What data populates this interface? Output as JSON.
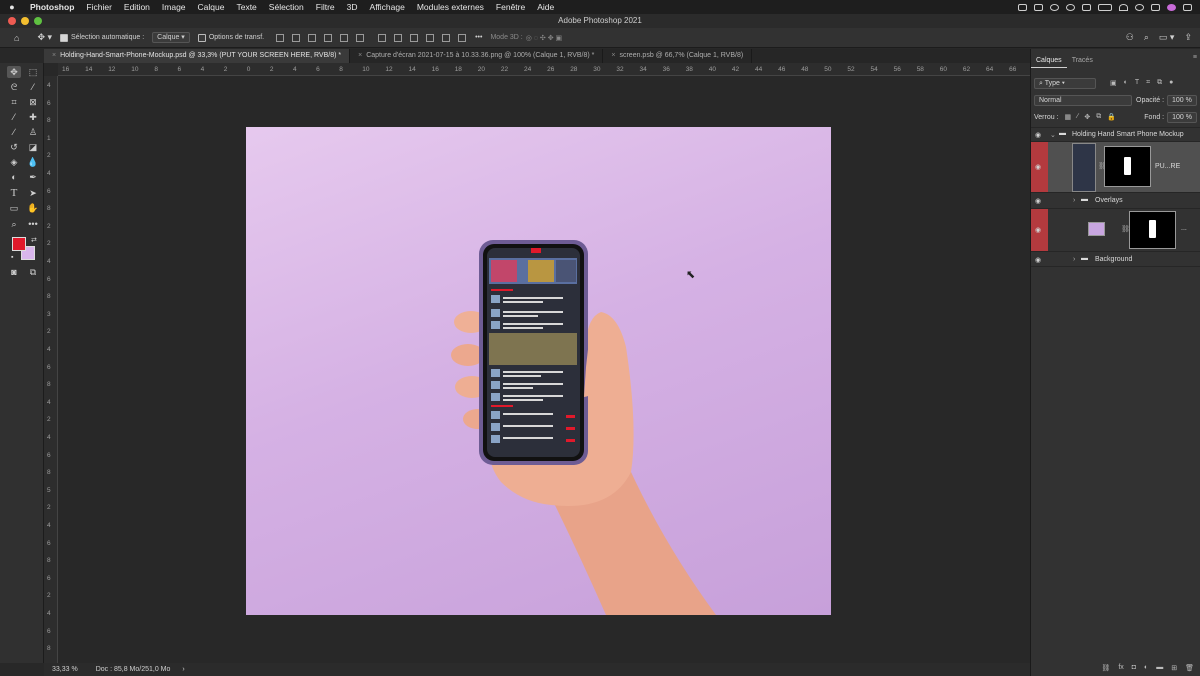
{
  "menubar": {
    "apple": "",
    "items": [
      "Photoshop",
      "Fichier",
      "Edition",
      "Image",
      "Calque",
      "Texte",
      "Sélection",
      "Filtre",
      "3D",
      "Affichage",
      "Modules externes",
      "Fenêtre",
      "Aide"
    ]
  },
  "window": {
    "title": "Adobe Photoshop 2021"
  },
  "options": {
    "auto_select_label": "Sélection automatique :",
    "auto_select_value": "Calque",
    "transform_label": "Options de transf.",
    "more": "•••",
    "mode3d": "Mode 3D :"
  },
  "tabs": [
    {
      "label": "Holding-Hand-Smart-Phone-Mockup.psd @ 33,3% (PUT YOUR SCREEN HERE, RVB/8) *"
    },
    {
      "label": "Capture d'écran 2021-07-15 à 10.33.36.png @ 100% (Calque 1, RVB/8) *"
    },
    {
      "label": "screen.psb @ 66,7% (Calque 1, RVB/8)"
    }
  ],
  "ruler_top": [
    "16",
    "18",
    "20",
    "22",
    "24",
    "26",
    "28",
    "30",
    "32",
    "34",
    "36",
    "38",
    "40",
    "42",
    "44",
    "46",
    "48",
    "50",
    "52",
    "54",
    "56",
    "58",
    "60",
    "62",
    "64",
    "66"
  ],
  "ruler_top_raw": [
    "16",
    "14",
    "12",
    "10",
    "8",
    "6",
    "4",
    "2",
    "0",
    "2",
    "4",
    "6",
    "8",
    "10",
    "12",
    "14",
    "16",
    "18",
    "20",
    "22",
    "24",
    "26",
    "28",
    "30",
    "32",
    "34",
    "36",
    "38",
    "40",
    "42",
    "44",
    "46",
    "48",
    "50",
    "52",
    "54",
    "56",
    "58",
    "60",
    "62",
    "64",
    "66"
  ],
  "ruler_left": [
    "4",
    "6",
    "8",
    "1",
    "2",
    "4",
    "6",
    "8",
    "2",
    "2",
    "4",
    "6",
    "8",
    "3",
    "2",
    "4",
    "6",
    "8",
    "4",
    "2",
    "4",
    "6",
    "8",
    "5",
    "2",
    "4",
    "6",
    "8",
    "6",
    "2",
    "4",
    "6",
    "8"
  ],
  "status": {
    "zoom": "33,33 %",
    "doc": "Doc : 85,8 Mo/251,0 Mo"
  },
  "colors": {
    "foreground": "#e0192b",
    "background": "#d9b6ec",
    "artboard": "#d5b1e4",
    "red_mask": "#b33a3e"
  },
  "panel": {
    "tabs": [
      "Calques",
      "Tracés"
    ],
    "filter_label": "Type",
    "blend_mode": "Normal",
    "opacity_label": "Opacité :",
    "opacity_value": "100 %",
    "lock_label": "Verrou :",
    "fill_label": "Fond :",
    "fill_value": "100 %",
    "layers": [
      {
        "name": "Holding Hand Smart Phone Mockup",
        "type": "group-open"
      },
      {
        "name": "PU...RE",
        "type": "smart-object"
      },
      {
        "name": "Overlays",
        "type": "group-closed"
      },
      {
        "name": "...",
        "type": "fill-mask"
      },
      {
        "name": "Background",
        "type": "group-closed"
      }
    ]
  }
}
